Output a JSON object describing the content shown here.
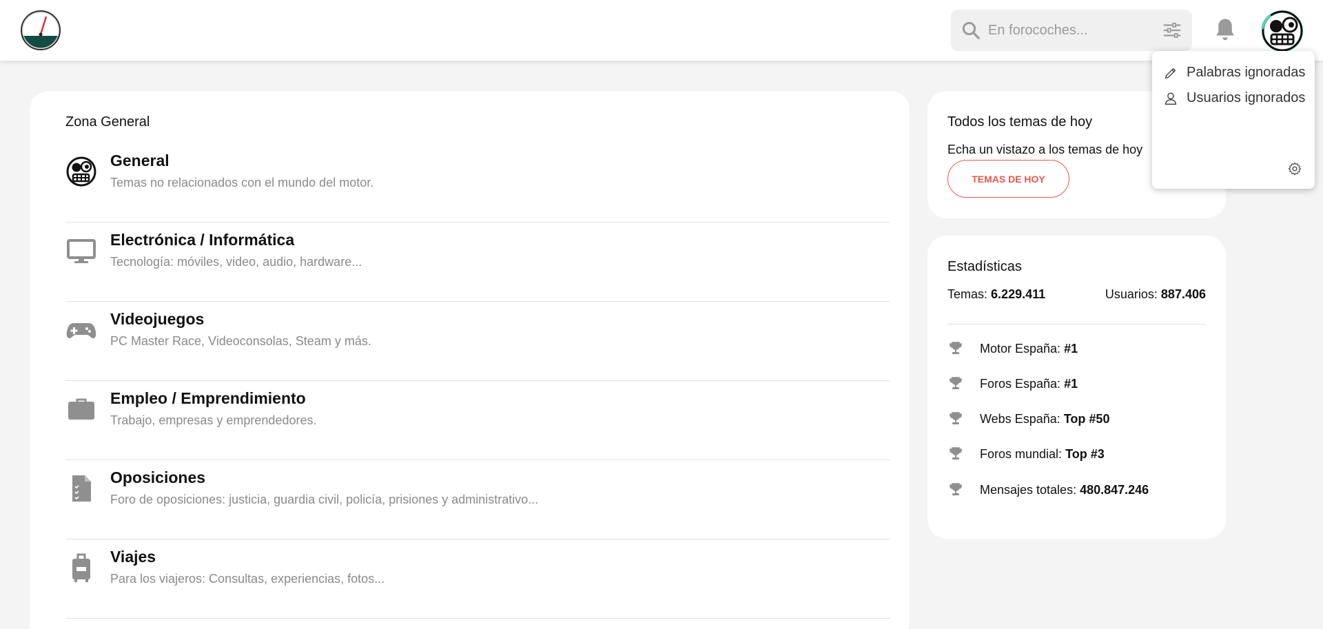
{
  "header": {
    "search_placeholder": "En forocoches..."
  },
  "dropdown": {
    "items": [
      {
        "label": "Palabras ignoradas",
        "icon": "pencil-icon"
      },
      {
        "label": "Usuarios ignorados",
        "icon": "user-icon"
      }
    ]
  },
  "main": {
    "zone_title": "Zona General",
    "forums": [
      {
        "title": "General",
        "description": "Temas no relacionados con el mundo del motor.",
        "icon": "general-mascot-icon"
      },
      {
        "title": "Electrónica / Informática",
        "description": "Tecnología: móviles, video, audio, hardware...",
        "icon": "monitor-icon"
      },
      {
        "title": "Videojuegos",
        "description": "PC Master Race, Videoconsolas, Steam y más.",
        "icon": "gamepad-icon"
      },
      {
        "title": "Empleo / Emprendimiento",
        "description": "Trabajo, empresas y emprendedores.",
        "icon": "briefcase-icon"
      },
      {
        "title": "Oposiciones",
        "description": "Foro de oposiciones: justicia, guardia civil, policía, prisiones y administrativo...",
        "icon": "document-checklist-icon"
      },
      {
        "title": "Viajes",
        "description": "Para los viajeros: Consultas, experiencias, fotos...",
        "icon": "luggage-icon"
      }
    ]
  },
  "today": {
    "title": "Todos los temas de hoy",
    "subtitle": "Echa un vistazo a los temas de hoy",
    "button": "TEMAS DE HOY"
  },
  "stats": {
    "title": "Estadísticas",
    "temas_label": "Temas:",
    "temas_value": "6.229.411",
    "usuarios_label": "Usuarios:",
    "usuarios_value": "887.406",
    "rankings": [
      {
        "label": "Motor España:",
        "value": "#1"
      },
      {
        "label": "Foros España:",
        "value": "#1"
      },
      {
        "label": "Webs España:",
        "value": "Top #50"
      },
      {
        "label": "Foros mundial:",
        "value": "Top #3"
      },
      {
        "label": "Mensajes totales:",
        "value": "480.847.246"
      }
    ]
  },
  "colors": {
    "accent": "#e8574c",
    "background": "#f4f4f4",
    "muted_text": "#8a8a8a",
    "icon_gray": "#8f8f8f"
  }
}
